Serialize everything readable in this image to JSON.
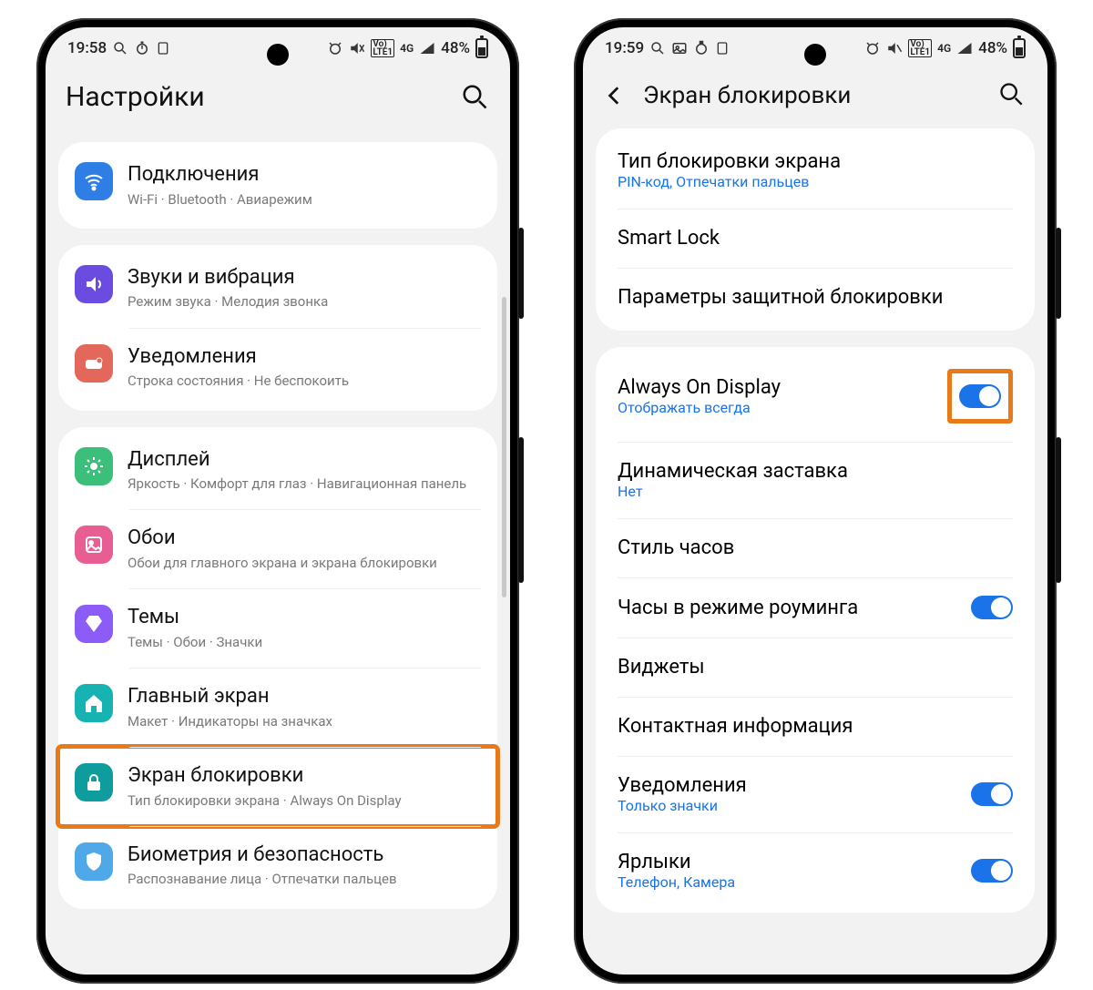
{
  "left": {
    "status": {
      "time": "19:58",
      "net": "4G",
      "lte": "LTE1",
      "vo": "Vo)",
      "batt": "48%"
    },
    "title": "Настройки",
    "groups": [
      [
        {
          "icon": "wifi-icon",
          "bg": "bg-blue",
          "title": "Подключения",
          "sub": "Wi-Fi · Bluetooth · Авиарежим"
        }
      ],
      [
        {
          "icon": "sound-icon",
          "bg": "bg-purple",
          "title": "Звуки и вибрация",
          "sub": "Режим звука · Мелодия звонка"
        },
        {
          "icon": "notif-icon",
          "bg": "bg-red",
          "title": "Уведомления",
          "sub": "Строка состояния · Не беспокоить"
        }
      ],
      [
        {
          "icon": "display-icon",
          "bg": "bg-green",
          "title": "Дисплей",
          "sub": "Яркость · Комфорт для глаз · Навигационная панель"
        },
        {
          "icon": "wall-icon",
          "bg": "bg-pink",
          "title": "Обои",
          "sub": "Обои для главного экрана и экрана блокировки"
        },
        {
          "icon": "themes-icon",
          "bg": "bg-violet",
          "title": "Темы",
          "sub": "Темы · Обои · Значки"
        },
        {
          "icon": "home-icon",
          "bg": "bg-teal",
          "title": "Главный экран",
          "sub": "Макет · Индикаторы на значках"
        },
        {
          "icon": "lock-icon",
          "bg": "bg-dteal",
          "title": "Экран блокировки",
          "sub": "Тип блокировки экрана · Always On Display",
          "hl": true
        },
        {
          "icon": "shield-icon",
          "bg": "bg-lblue",
          "title": "Биометрия и безопасность",
          "sub": "Распознавание лица · Отпечатки пальцев"
        }
      ]
    ]
  },
  "right": {
    "status": {
      "time": "19:59",
      "net": "4G",
      "lte": "LTE1",
      "vo": "Vo)",
      "batt": "48%"
    },
    "title": "Экран блокировки",
    "groups": [
      [
        {
          "title": "Тип блокировки экрана",
          "sub": "PIN-код, Отпечатки пальцев",
          "link": true
        },
        {
          "title": "Smart Lock"
        },
        {
          "title": "Параметры защитной блокировки"
        }
      ],
      [
        {
          "title": "Always On Display",
          "sub": "Отображать всегда",
          "link": true,
          "switch": true,
          "hl": true
        },
        {
          "title": "Динамическая заставка",
          "sub": "Нет",
          "link": true
        },
        {
          "title": "Стиль часов"
        },
        {
          "title": "Часы в режиме роуминга",
          "switch": true
        },
        {
          "title": "Виджеты"
        },
        {
          "title": "Контактная информация"
        },
        {
          "title": "Уведомления",
          "sub": "Только значки",
          "link": true,
          "switch": true
        },
        {
          "title": "Ярлыки",
          "sub": "Телефон, Камера",
          "link": true,
          "switch": true
        }
      ]
    ]
  }
}
